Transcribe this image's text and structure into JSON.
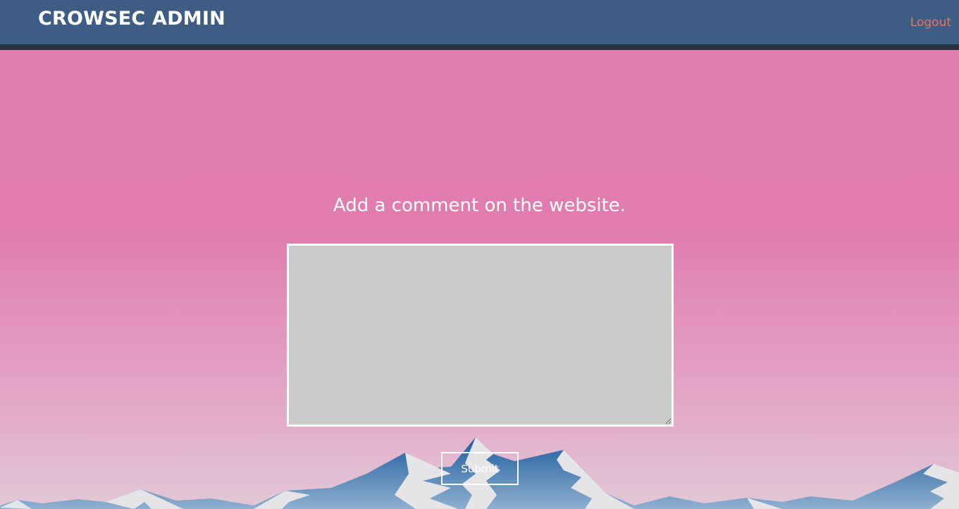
{
  "navbar": {
    "brand": "CROWSEC ADMIN",
    "logout_label": "Logout"
  },
  "main": {
    "heading": "Add a comment on the website.",
    "comment_value": "",
    "submit_label": "Submit"
  },
  "colors": {
    "navbar_bg": "#3e5d84",
    "navbar_border": "#283341",
    "logout_link": "#e7735c",
    "background_top": "#e07fb1",
    "background_bottom": "#e2c8d6",
    "textarea_bg": "#cacaca",
    "mountain_blue": "#2f69a3",
    "mountain_snow": "#e5e5e8"
  },
  "icons": {
    "background_art": "mountains-illustration"
  }
}
